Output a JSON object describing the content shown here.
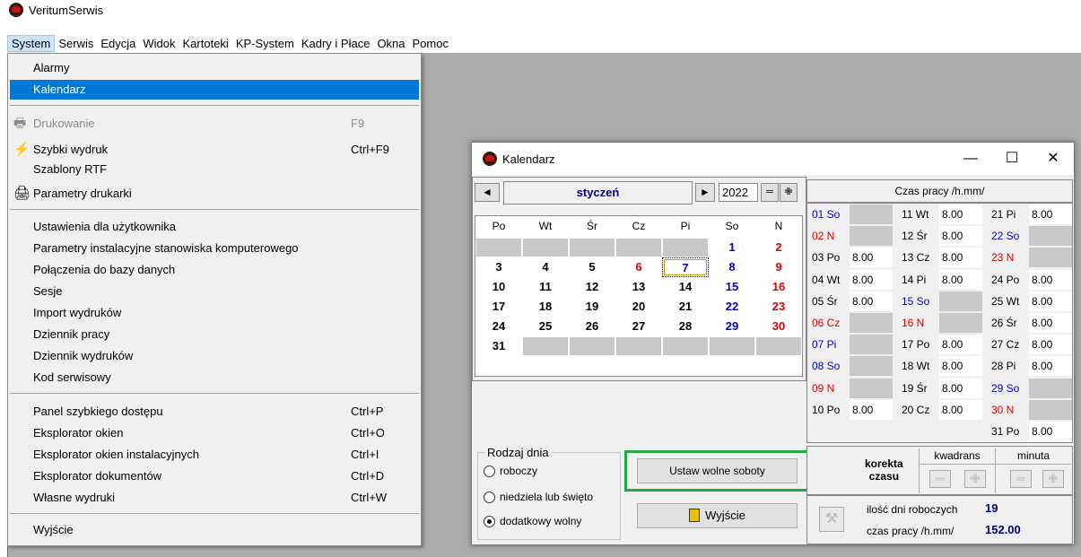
{
  "app": {
    "title": "VeritumSerwis"
  },
  "menubar": [
    "System",
    "Serwis",
    "Edycja",
    "Widok",
    "Kartoteki",
    "KP-System",
    "Kadry i Płace",
    "Okna",
    "Pomoc"
  ],
  "menu": {
    "alarmy": "Alarmy",
    "kalendarz": "Kalendarz",
    "drukowanie": "Drukowanie",
    "drukowanie_sc": "F9",
    "szybki": "Szybki wydruk",
    "szybki_sc": "Ctrl+F9",
    "szablony": "Szablony RTF",
    "parametry_drukarki": "Parametry drukarki",
    "ustawienia": "Ustawienia dla użytkownika",
    "param_inst": "Parametry instalacyjne stanowiska komputerowego",
    "polaczenia": "Połączenia do bazy danych",
    "sesje": "Sesje",
    "import": "Import wydruków",
    "dziennik_pracy": "Dziennik pracy",
    "dziennik_wydrukow": "Dziennik wydruków",
    "kod": "Kod serwisowy",
    "panel": "Panel szybkiego dostępu",
    "panel_sc": "Ctrl+P",
    "eksplorator": "Eksplorator okien",
    "eksplorator_sc": "Ctrl+O",
    "eksplorator_inst": "Eksplorator okien instalacyjnych",
    "eksplorator_inst_sc": "Ctrl+I",
    "eksplorator_dok": "Eksplorator dokumentów",
    "eksplorator_dok_sc": "Ctrl+D",
    "wlasne": "Własne wydruki",
    "wlasne_sc": "Ctrl+W",
    "wyjscie": "Wyjście"
  },
  "window": {
    "title": "Kalendarz",
    "minimize": "—",
    "maximize": "☐",
    "close": "✕"
  },
  "nav": {
    "prev": "◄",
    "month": "styczeń",
    "next": "►",
    "year": "2022",
    "minus": "═",
    "plus": "✙"
  },
  "calendar": {
    "days": [
      "Po",
      "Wt",
      "Śr",
      "Cz",
      "Pi",
      "So",
      "N"
    ],
    "weeks": [
      [
        "",
        "",
        "",
        "",
        "",
        "1",
        "2"
      ],
      [
        "3",
        "4",
        "5",
        "6",
        "7",
        "8",
        "9"
      ],
      [
        "10",
        "11",
        "12",
        "13",
        "14",
        "15",
        "16"
      ],
      [
        "17",
        "18",
        "19",
        "20",
        "21",
        "22",
        "23"
      ],
      [
        "24",
        "25",
        "26",
        "27",
        "28",
        "29",
        "30"
      ],
      [
        "31",
        "",
        "",
        "",
        "",
        "",
        ""
      ]
    ]
  },
  "legend": {
    "title": "Rodzaj dnia",
    "roboczy": "roboczy",
    "niedziela": "niedziela lub święto",
    "dodatkowy": "dodatkowy wolny",
    "selected": "dodatkowy wolny"
  },
  "buttons": {
    "ustaw": "Ustaw wolne soboty",
    "wyjscie": "Wyjście"
  },
  "czas": {
    "header": "Czas pracy /h.mm/",
    "col1": [
      [
        "01 So",
        ""
      ],
      [
        "02 N",
        ""
      ],
      [
        "03 Po",
        "8.00"
      ],
      [
        "04 Wt",
        "8.00"
      ],
      [
        "05 Śr",
        "8.00"
      ],
      [
        "06 Cz",
        ""
      ],
      [
        "07 Pi",
        ""
      ],
      [
        "08 So",
        ""
      ],
      [
        "09 N",
        ""
      ],
      [
        "10 Po",
        "8.00"
      ]
    ],
    "col2": [
      [
        "11 Wt",
        "8.00"
      ],
      [
        "12 Śr",
        "8.00"
      ],
      [
        "13 Cz",
        "8.00"
      ],
      [
        "14 Pi",
        "8.00"
      ],
      [
        "15 So",
        ""
      ],
      [
        "16 N",
        ""
      ],
      [
        "17 Po",
        "8.00"
      ],
      [
        "18 Wt",
        "8.00"
      ],
      [
        "19 Śr",
        "8.00"
      ],
      [
        "20 Cz",
        "8.00"
      ]
    ],
    "col3": [
      [
        "21 Pi",
        "8.00"
      ],
      [
        "22 So",
        ""
      ],
      [
        "23 N",
        ""
      ],
      [
        "24 Po",
        "8.00"
      ],
      [
        "25 Wt",
        "8.00"
      ],
      [
        "26 Śr",
        "8.00"
      ],
      [
        "27 Cz",
        "8.00"
      ],
      [
        "28 Pi",
        "8.00"
      ],
      [
        "29 So",
        ""
      ],
      [
        "30 N",
        ""
      ],
      [
        "31 Po",
        "8.00"
      ]
    ]
  },
  "korekta": {
    "label1": "korekta",
    "label2": "czasu",
    "kwadrans": "kwadrans",
    "minuta": "minuta",
    "minus": "═",
    "plus": "✙"
  },
  "summary": {
    "dni_label": "ilość dni roboczych",
    "dni_value": "19",
    "czas_label": "czas pracy /h.mm/",
    "czas_value": "152.00"
  },
  "colors": {
    "red": "#e00000",
    "blue": "#0000d0",
    "highlight": "#0078d7",
    "green_frame": "#22a745"
  }
}
